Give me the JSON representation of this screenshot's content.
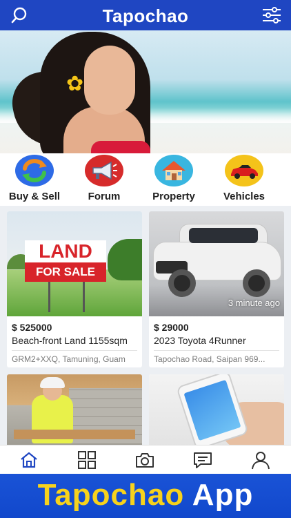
{
  "app": {
    "title": "Tapochao"
  },
  "header": {
    "search_icon": "search-icon",
    "filter_icon": "sliders-icon"
  },
  "categories": [
    {
      "label": "Buy & Sell",
      "icon": "exchange-arrows-icon",
      "color": "#2e6be6"
    },
    {
      "label": "Forum",
      "icon": "megaphone-icon",
      "color": "#d62b2b"
    },
    {
      "label": "Property",
      "icon": "house-icon",
      "color": "#39b6e0"
    },
    {
      "label": "Vehicles",
      "icon": "car-icon",
      "color": "#f4c31a"
    }
  ],
  "listings": [
    {
      "price": "$ 525000",
      "title": "Beach-front Land 1155sqm",
      "location": "GRM2+XXQ, Tamuning, Guam",
      "sign_top": "LAND",
      "sign_bottom": "FOR SALE"
    },
    {
      "price": "$ 29000",
      "title": "2023 Toyota 4Runner",
      "location": "Tapochao Road, Saipan 969...",
      "time": "3 minute ago"
    },
    {
      "image": "construction-worker"
    },
    {
      "image": "smartphone-in-hand"
    }
  ],
  "tabbar": {
    "items": [
      "home-icon",
      "grid-icon",
      "camera-icon",
      "chat-icon",
      "user-icon"
    ],
    "active": "home-icon"
  },
  "footer": {
    "word1": "Tapochao",
    "word2": "App"
  },
  "colors": {
    "brand_blue": "#1f46c2",
    "accent_yellow": "#f7d21c",
    "sign_red": "#d8242a"
  }
}
